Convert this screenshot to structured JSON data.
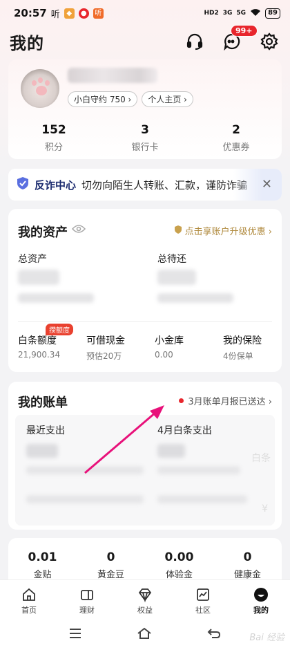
{
  "status_bar": {
    "time": "20:57",
    "mini_apps": [
      "听",
      "听"
    ],
    "signal_1": "HD2",
    "signal_2": "3G",
    "signal_3": "5G",
    "battery": "89"
  },
  "header": {
    "title": "我的",
    "message_badge": "99+",
    "icons": [
      "headset-icon",
      "message-icon",
      "gear-icon"
    ]
  },
  "profile": {
    "pill_credit": "小白守约 750 ›",
    "pill_home": "个人主页 ›",
    "stats": [
      {
        "value": "152",
        "label": "积分"
      },
      {
        "value": "3",
        "label": "银行卡"
      },
      {
        "value": "2",
        "label": "优惠券"
      }
    ]
  },
  "fraud": {
    "title": "反诈中心",
    "text": "切勿向陌生人转账、汇款，谨防诈骗"
  },
  "assets": {
    "title": "我的资产",
    "upgrade": "点击享账户升级优惠 ›",
    "total_assets_label": "总资产",
    "total_due_label": "总待还",
    "items": [
      {
        "name": "白条额度",
        "value": "21,900.34",
        "tag": "攒额度"
      },
      {
        "name": "可借现金",
        "value": "预估20万",
        "tag": ""
      },
      {
        "name": "小金库",
        "value": "0.00",
        "tag": ""
      },
      {
        "name": "我的保险",
        "value": "4份保单",
        "tag": ""
      }
    ]
  },
  "bills": {
    "title": "我的账单",
    "notice": "3月账单月报已送达 ›",
    "recent_label": "最近支出",
    "april_label": "4月白条支出",
    "side_text_1": "白条",
    "side_text_2": "¥"
  },
  "mini_stats": [
    {
      "value": "0.01",
      "label": "金贴"
    },
    {
      "value": "0",
      "label": "黄金豆"
    },
    {
      "value": "0.00",
      "label": "体验金"
    },
    {
      "value": "0",
      "label": "健康金"
    }
  ],
  "tabs": [
    {
      "label": "首页",
      "icon": "home-icon"
    },
    {
      "label": "理财",
      "icon": "wallet-icon"
    },
    {
      "label": "权益",
      "icon": "diamond-icon"
    },
    {
      "label": "社区",
      "icon": "chart-icon"
    },
    {
      "label": "我的",
      "icon": "profile-icon"
    }
  ],
  "watermark": "Bai 经验",
  "colors": {
    "accent_red": "#e8262d",
    "gold": "#b08a3e",
    "annotation_arrow": "#e8117a"
  }
}
